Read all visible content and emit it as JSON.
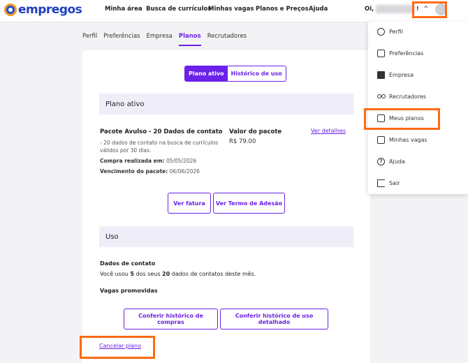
{
  "brand": {
    "name": "empregos"
  },
  "nav": {
    "items": [
      "Minha área",
      "Busca de currículos",
      "Minhas vagas",
      "Planos e Preços",
      "Ajuda"
    ],
    "greeting": "Oi,",
    "name_suffix": "!",
    "caret": "^"
  },
  "tabs": [
    "Perfil",
    "Preferências",
    "Empresa",
    "Planos",
    "Recrutadores"
  ],
  "active_tab": "Planos",
  "toggle": {
    "active": "Plano ativo",
    "history": "Histórico de uso"
  },
  "plan_section": {
    "title": "Plano ativo",
    "name": "Pacote Avulso - 20 Dados de contato",
    "description_1": "- 20 dados de contato na busca de currículos",
    "description_2": "válidos por 30 dias.",
    "purchase_label": "Compra realizada em:",
    "purchase_date": "05/05/2026",
    "expiry_label": "Vencimento do pacote:",
    "expiry_date": "06/06/2026",
    "value_label": "Valor do pacote",
    "value_amount": "R$ 79.00",
    "details_link": "Ver detalhes",
    "invoice_button": "Ver fatura",
    "terms_button": "Ver Termo de Adesão"
  },
  "usage_section": {
    "title": "Uso",
    "contact_title": "Dados de contato",
    "usage_pre": "Você usou",
    "used": "5",
    "usage_mid": "dos seus",
    "total": "20",
    "usage_post": "dados de contatos deste mês.",
    "promoted_title": "Vagas promovidas",
    "purchase_history_button": "Conferir histórico de compras",
    "usage_history_button": "Conferir histórico de uso detalhado",
    "cancel_link": "Cancelar plano"
  },
  "dropdown": {
    "items": [
      {
        "label": "Perfil",
        "icon": "user-circle-icon"
      },
      {
        "label": "Preferências",
        "icon": "preferences-icon"
      },
      {
        "label": "Empresa",
        "icon": "building-icon"
      },
      {
        "label": "Recrutadores",
        "icon": "people-icon"
      },
      {
        "label": "Meus planos",
        "icon": "plan-card-icon"
      },
      {
        "label": "Minhas vagas",
        "icon": "briefcase-icon"
      },
      {
        "label": "Ajuda",
        "icon": "help-icon"
      },
      {
        "label": "Sair",
        "icon": "exit-icon"
      }
    ]
  },
  "colors": {
    "accent": "#6b21e8",
    "highlight": "#ff6a13",
    "brand_blue": "#1f3fbf",
    "brand_orange": "#f59a23"
  }
}
